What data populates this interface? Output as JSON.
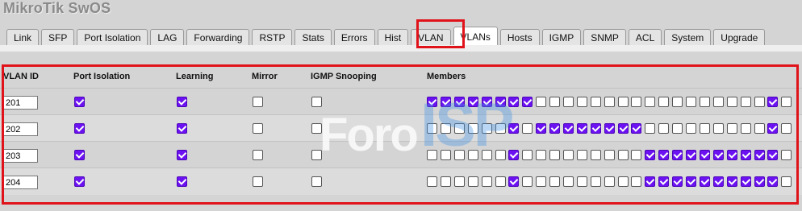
{
  "app_title": "MikroTik SwOS",
  "tabs": [
    "Link",
    "SFP",
    "Port Isolation",
    "LAG",
    "Forwarding",
    "RSTP",
    "Stats",
    "Errors",
    "Hist",
    "VLAN",
    "VLANs",
    "Hosts",
    "IGMP",
    "SNMP",
    "ACL",
    "System",
    "Upgrade"
  ],
  "active_tab": "VLANs",
  "colors": {
    "checkbox_on": "#6c11f2",
    "highlight": "#e0121a"
  },
  "table": {
    "headers": {
      "vlan_id": "VLAN ID",
      "port_isolation": "Port Isolation",
      "learning": "Learning",
      "mirror": "Mirror",
      "igmp_snooping": "IGMP Snooping",
      "members": "Members"
    },
    "rows": [
      {
        "vlan_id": "201",
        "port_isolation": true,
        "learning": true,
        "mirror": false,
        "igmp_snooping": false,
        "members": [
          1,
          1,
          1,
          1,
          1,
          1,
          1,
          1,
          0,
          0,
          0,
          0,
          0,
          0,
          0,
          0,
          0,
          0,
          0,
          0,
          0,
          0,
          0,
          0,
          0,
          1,
          0
        ]
      },
      {
        "vlan_id": "202",
        "port_isolation": true,
        "learning": true,
        "mirror": false,
        "igmp_snooping": false,
        "members": [
          0,
          0,
          0,
          0,
          0,
          0,
          1,
          0,
          1,
          1,
          1,
          1,
          1,
          1,
          1,
          1,
          0,
          0,
          0,
          0,
          0,
          0,
          0,
          0,
          0,
          1,
          0
        ]
      },
      {
        "vlan_id": "203",
        "port_isolation": true,
        "learning": true,
        "mirror": false,
        "igmp_snooping": false,
        "members": [
          0,
          0,
          0,
          0,
          0,
          0,
          1,
          0,
          0,
          0,
          0,
          0,
          0,
          0,
          0,
          0,
          1,
          1,
          1,
          1,
          1,
          1,
          1,
          1,
          1,
          1,
          0
        ]
      },
      {
        "vlan_id": "204",
        "port_isolation": true,
        "learning": true,
        "mirror": false,
        "igmp_snooping": false,
        "members": [
          0,
          0,
          0,
          0,
          0,
          0,
          1,
          0,
          0,
          0,
          0,
          0,
          0,
          0,
          0,
          0,
          1,
          1,
          1,
          1,
          1,
          1,
          1,
          1,
          1,
          1,
          0
        ]
      }
    ]
  },
  "watermark": {
    "part1": "Foro",
    "part2": "ISP"
  }
}
